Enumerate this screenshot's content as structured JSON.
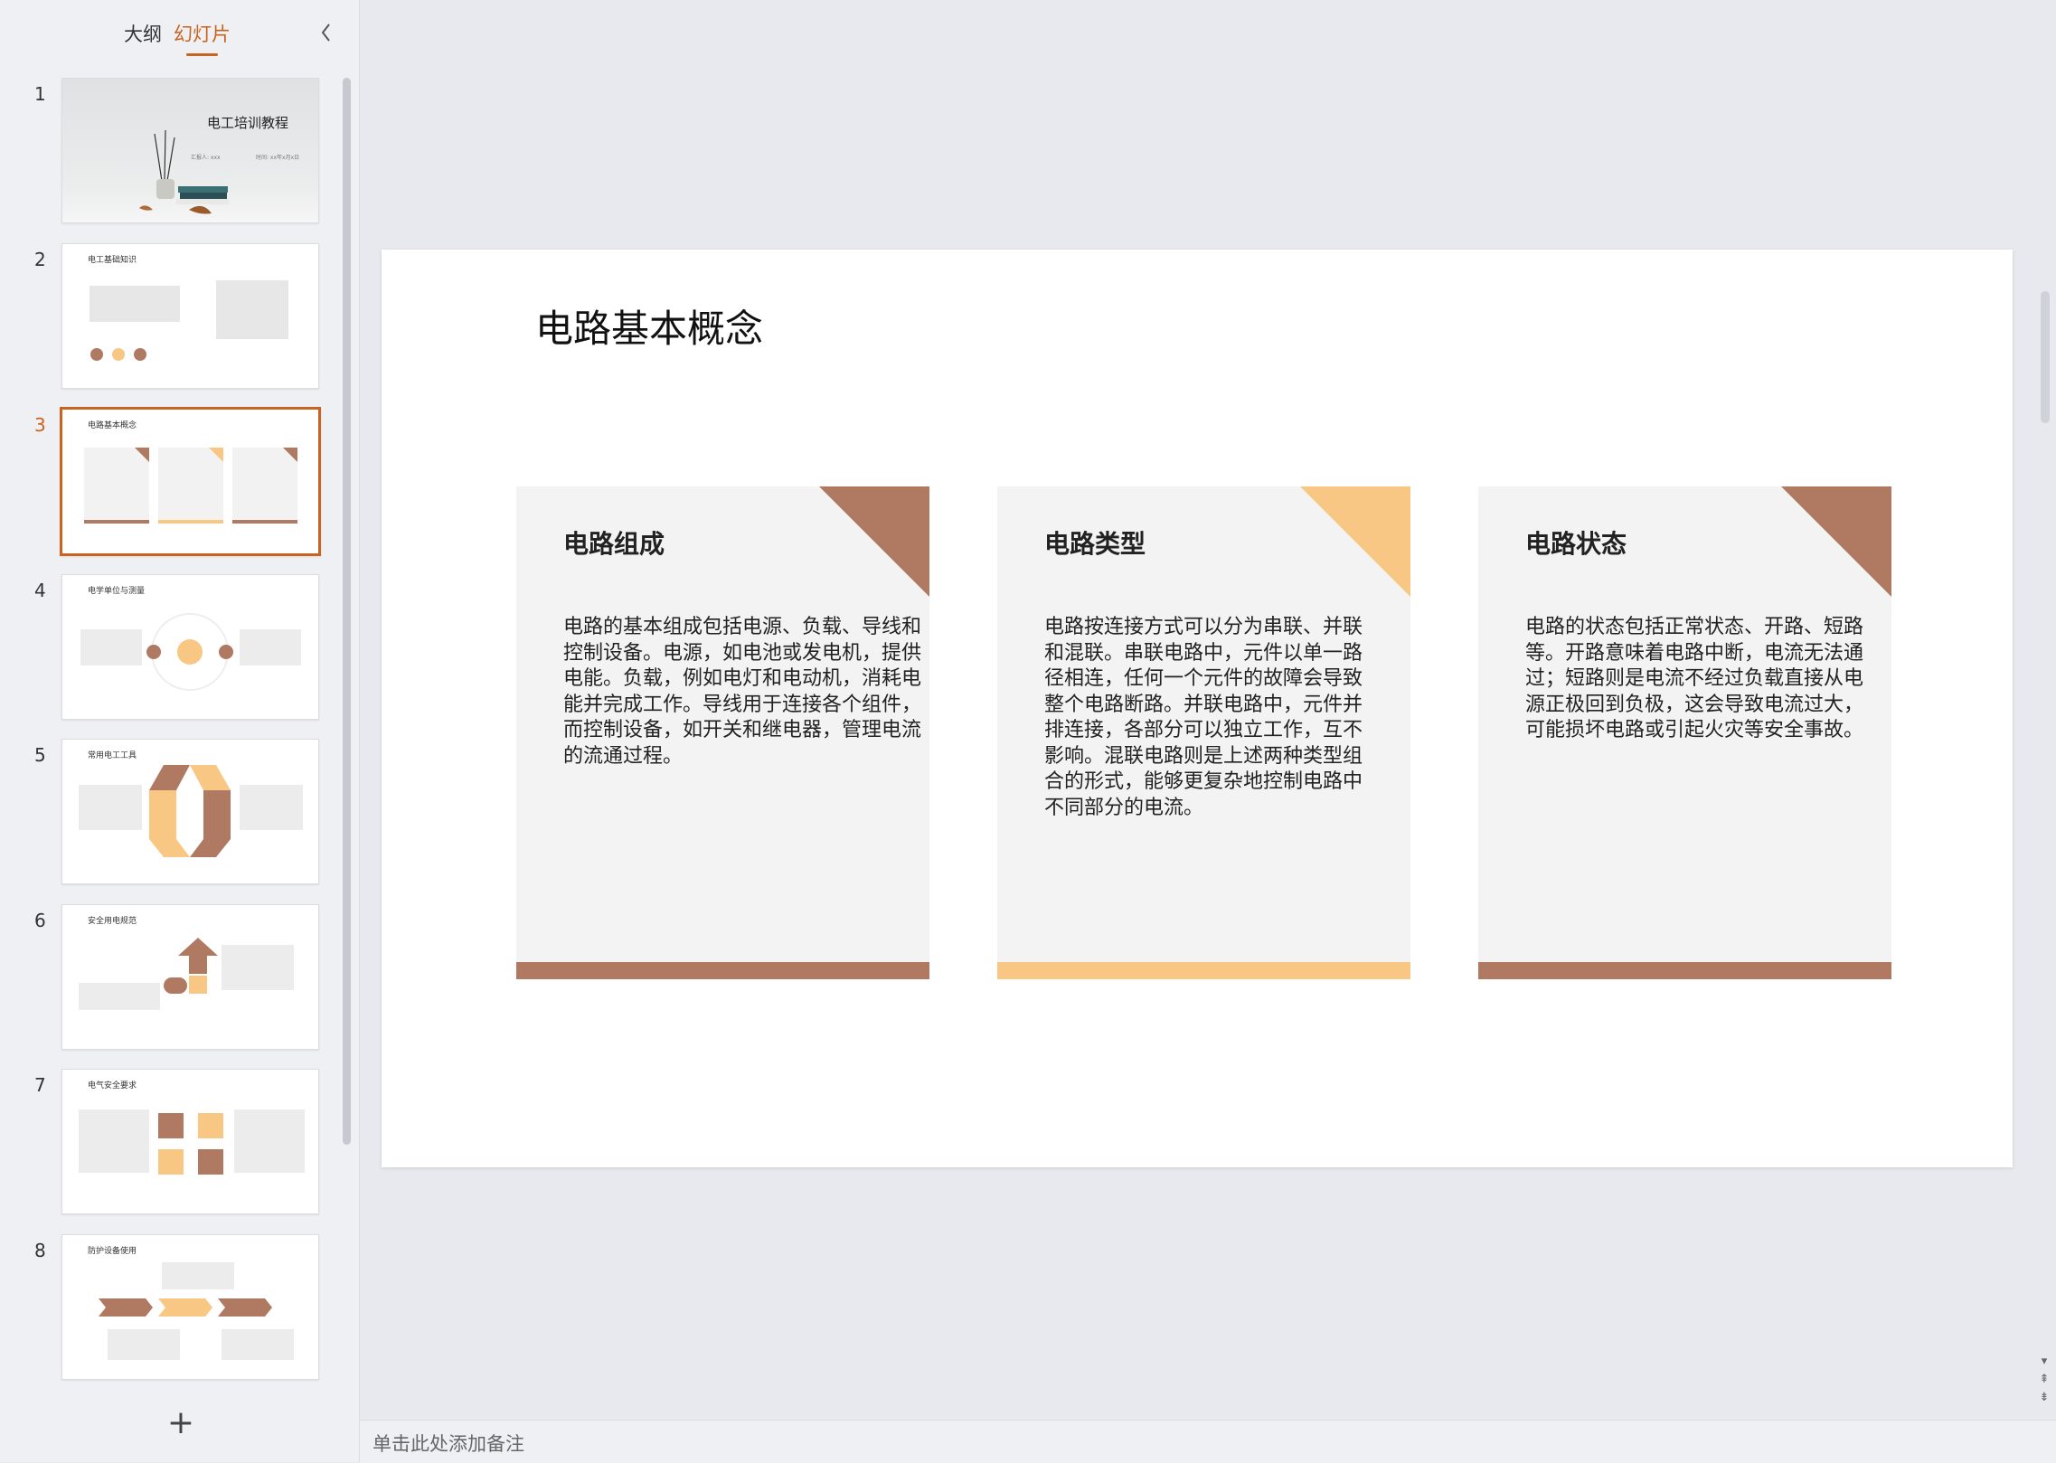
{
  "sidebar": {
    "tabs": {
      "outline": "大纲",
      "slides": "幻灯片"
    },
    "slides": [
      {
        "num": "1",
        "title": "电工培训教程",
        "meta_left": "汇报人: xxx",
        "meta_right": "时间: xx年x月x日"
      },
      {
        "num": "2",
        "title": "电工基础知识"
      },
      {
        "num": "3",
        "title": "电路基本概念"
      },
      {
        "num": "4",
        "title": "电学单位与测量"
      },
      {
        "num": "5",
        "title": "常用电工工具"
      },
      {
        "num": "6",
        "title": "安全用电规范"
      },
      {
        "num": "7",
        "title": "电气安全要求"
      },
      {
        "num": "8",
        "title": "防护设备使用"
      }
    ],
    "add_label": "+"
  },
  "slide": {
    "title": "电路基本概念",
    "cards": [
      {
        "heading": "电路组成",
        "accent": "#b07a62",
        "body": "电路的基本组成包括电源、负载、导线和控制设备。电源，如电池或发电机，提供电能。负载，例如电灯和电动机，消耗电能并完成工作。导线用于连接各个组件，而控制设备，如开关和继电器，管理电流的流通过程。"
      },
      {
        "heading": "电路类型",
        "accent": "#f7c783",
        "body": "电路按连接方式可以分为串联、并联和混联。串联电路中，元件以单一路径相连，任何一个元件的故障会导致整个电路断路。并联电路中，元件并排连接，各部分可以独立工作，互不影响。混联电路则是上述两种类型组合的形式，能够更复杂地控制电路中不同部分的电流。"
      },
      {
        "heading": "电路状态",
        "accent": "#b07a62",
        "body": "电路的状态包括正常状态、开路、短路等。开路意味着电路中断，电流无法通过；短路则是电流不经过负载直接从电源正极回到负极，这会导致电流过大，可能损坏电路或引起火灾等安全事故。"
      }
    ]
  },
  "notes": {
    "placeholder": "单击此处添加备注"
  },
  "colors": {
    "accent": "#c8641f",
    "brown": "#b07a62",
    "yellow": "#f7c783"
  }
}
